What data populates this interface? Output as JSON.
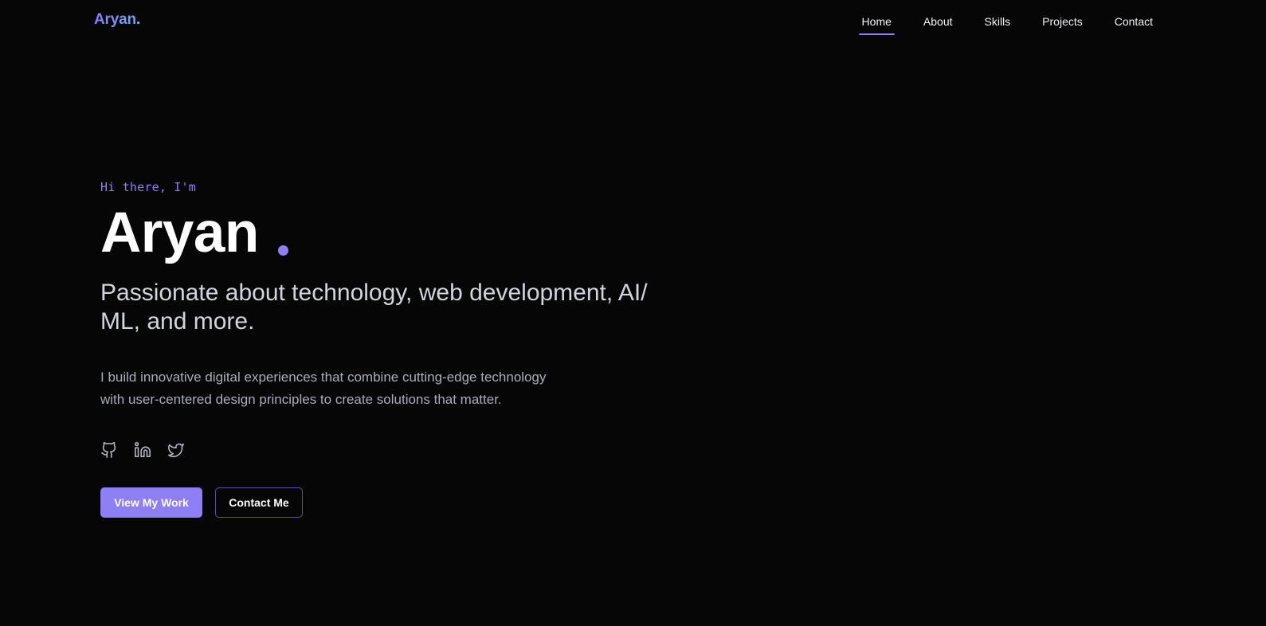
{
  "header": {
    "logo_text": "Aryan",
    "logo_dot": ".",
    "nav": [
      {
        "label": "Home",
        "active": true
      },
      {
        "label": "About",
        "active": false
      },
      {
        "label": "Skills",
        "active": false
      },
      {
        "label": "Projects",
        "active": false
      },
      {
        "label": "Contact",
        "active": false
      }
    ]
  },
  "hero": {
    "greeting": "Hi there, I'm",
    "name": "Aryan",
    "tagline": "Passionate about technology, web development, AI/ ML, and more.",
    "description": "I build innovative digital experiences that combine cutting-edge technology with user-centered design principles to create solutions that matter.",
    "socials": [
      {
        "icon": "github-icon"
      },
      {
        "icon": "linkedin-icon"
      },
      {
        "icon": "twitter-icon"
      }
    ],
    "primary_button": "View My Work",
    "secondary_button": "Contact Me"
  },
  "colors": {
    "background": "#060607",
    "accent": "#8f7ff5",
    "text_muted": "#a8adba"
  }
}
